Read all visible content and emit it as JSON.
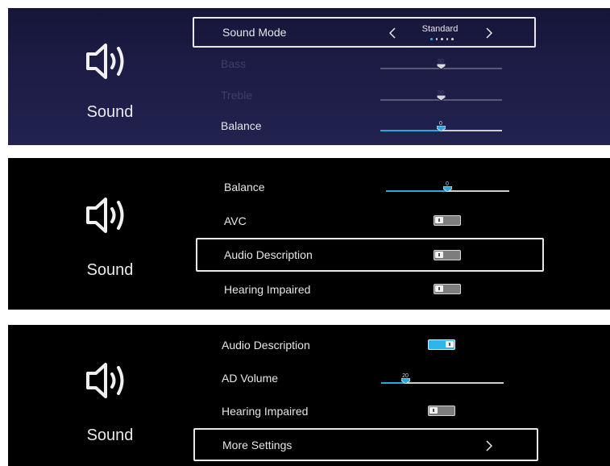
{
  "screens": [
    {
      "category": "Sound",
      "rows": [
        {
          "label": "Sound Mode",
          "value": "Standard",
          "dots_total": 5,
          "dots_active": 1
        },
        {
          "label": "Bass",
          "value": "50",
          "level": 0.5,
          "enabled": false
        },
        {
          "label": "Treble",
          "value": "50",
          "level": 0.5,
          "enabled": false
        },
        {
          "label": "Balance",
          "value": "0",
          "level": 0.5,
          "enabled": true
        }
      ]
    },
    {
      "category": "Sound",
      "rows": [
        {
          "label": "Balance",
          "value": "0",
          "level": 0.5
        },
        {
          "label": "AVC",
          "state": "off"
        },
        {
          "label": "Audio Description",
          "state": "off"
        },
        {
          "label": "Hearing Impaired",
          "state": "off"
        }
      ]
    },
    {
      "category": "Sound",
      "rows": [
        {
          "label": "Audio Description",
          "state": "on"
        },
        {
          "label": "AD Volume",
          "value": "20",
          "level": 0.2
        },
        {
          "label": "Hearing Impaired",
          "state": "off"
        },
        {
          "label": "More Settings"
        }
      ]
    }
  ],
  "icons": {
    "category": "speaker-icon",
    "prev": "chevron-left-icon",
    "next": "chevron-right-icon",
    "more": "chevron-right-icon"
  },
  "colors": {
    "accent": "#2aa7df",
    "panel_top": "#1c1c46",
    "panel_black": "#000000",
    "toggle_on": "#2fb6e8",
    "toggle_off": "#7d7d7d"
  }
}
